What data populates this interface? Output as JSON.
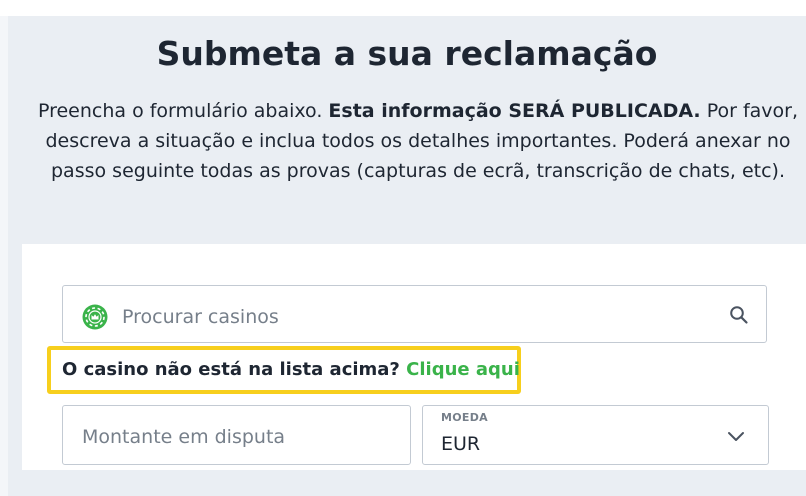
{
  "page": {
    "title": "Submeta a sua reclamação",
    "intro": {
      "part1": "Preencha o formulário abaixo. ",
      "bold": "Esta informação SERÁ PUBLICADA.",
      "part2": " Por favor, descreva a situação e inclua todos os detalhes importantes. Poderá anexar no passo seguinte todas as provas (capturas de ecrã, transcrição de chats, etc)."
    }
  },
  "form": {
    "search": {
      "placeholder": "Procurar casinos",
      "logo_icon": "casino-chip-logo",
      "search_icon": "magnifier"
    },
    "not_listed": {
      "text": "O casino não está na lista acima?",
      "link": "Clique aqui"
    },
    "amount": {
      "placeholder": "Montante em disputa"
    },
    "currency": {
      "label": "MOEDA",
      "value": "EUR",
      "icon": "chevron-down"
    }
  },
  "colors": {
    "accent_green": "#3ab34a",
    "highlight_yellow": "#f7cf1d",
    "text_dark": "#1e2632",
    "placeholder_gray": "#767f8a",
    "panel_bg": "#eaeef3"
  }
}
